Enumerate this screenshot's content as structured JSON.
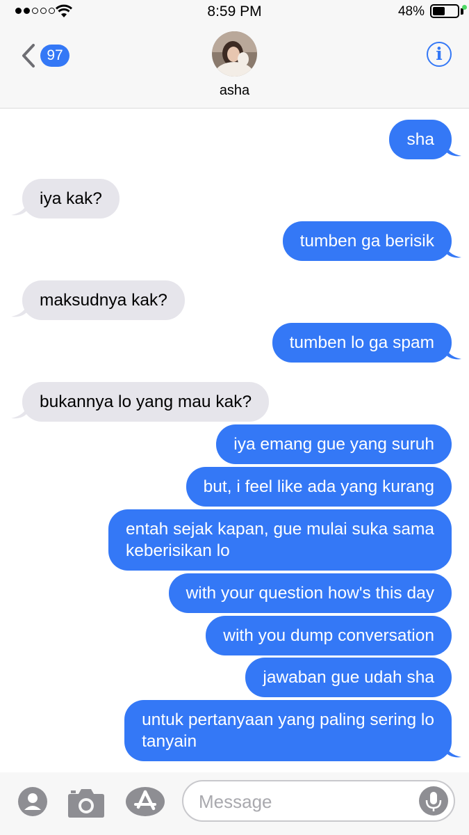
{
  "status_bar": {
    "time": "8:59 PM",
    "battery": "48%",
    "battery_level": 0.48,
    "signal_bars": 2
  },
  "header": {
    "back_count": "97",
    "contact_name": "asha",
    "info_label": "i"
  },
  "messages": [
    {
      "side": "sent",
      "text": "sha"
    },
    {
      "side": "received",
      "text": "iya kak?"
    },
    {
      "side": "sent",
      "text": "tumben ga berisik"
    },
    {
      "side": "received",
      "text": "maksudnya kak?"
    },
    {
      "side": "sent",
      "text": "tumben lo ga spam"
    },
    {
      "side": "received",
      "text": "bukannya lo yang mau kak?"
    },
    {
      "side": "sent",
      "text": "iya emang gue yang suruh"
    },
    {
      "side": "sent",
      "text": "but, i feel like ada yang kurang"
    },
    {
      "side": "sent",
      "text": "entah sejak kapan, gue mulai suka sama\nkeberisikan lo"
    },
    {
      "side": "sent",
      "text": "with your question how's this day"
    },
    {
      "side": "sent",
      "text": "with you dump conversation"
    },
    {
      "side": "sent",
      "text": "jawaban gue udah sha"
    },
    {
      "side": "sent",
      "text": "untuk pertanyaan yang paling sering lo\ntanyain"
    }
  ],
  "composer": {
    "placeholder": "Message"
  },
  "colors": {
    "accent": "#3478f6",
    "received_bubble": "#e6e5eb",
    "bar_bg": "#f7f7f7"
  }
}
